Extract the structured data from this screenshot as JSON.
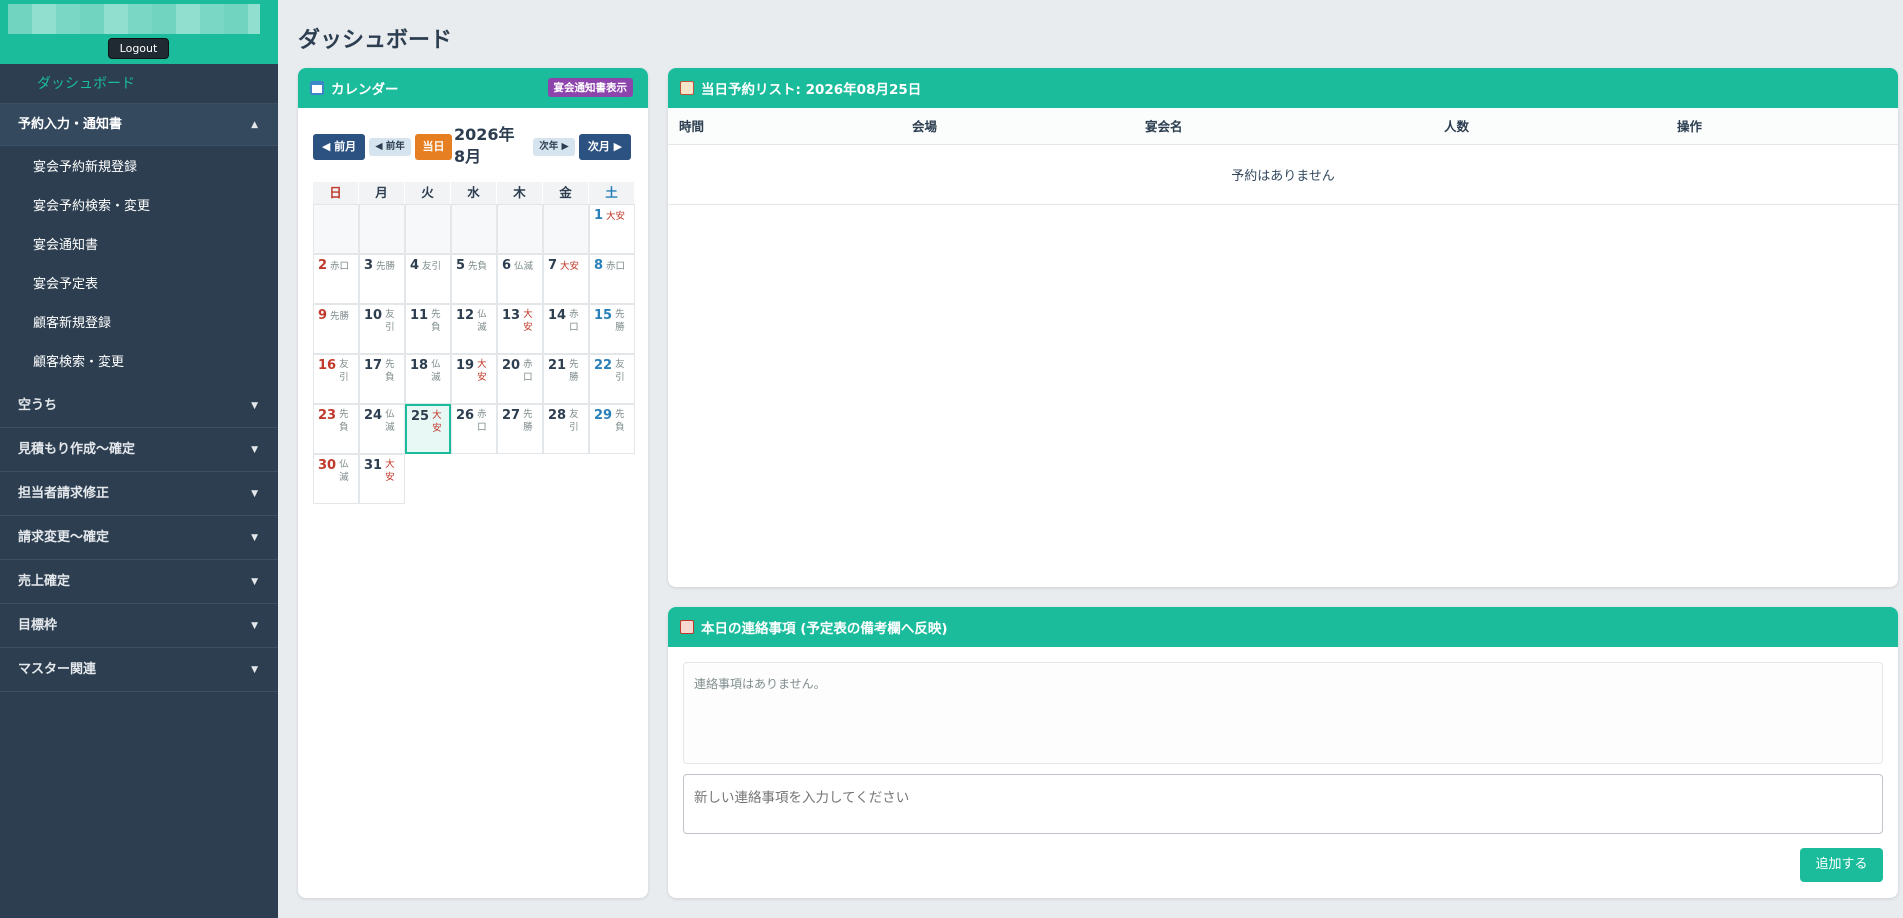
{
  "sidebar": {
    "logout": "Logout",
    "dashboard": "ダッシュボード",
    "sections": [
      {
        "label": "予約入力・通知書",
        "open": true
      },
      {
        "label": "空うち"
      },
      {
        "label": "見積もり作成〜確定"
      },
      {
        "label": "担当者請求修正"
      },
      {
        "label": "請求変更〜確定"
      },
      {
        "label": "売上確定"
      },
      {
        "label": "目標枠"
      },
      {
        "label": "マスター関連"
      }
    ],
    "subitems": [
      "宴会予約新規登録",
      "宴会予約検索・変更",
      "宴会通知書",
      "宴会予定表",
      "顧客新規登録",
      "顧客検索・変更"
    ],
    "arrow_up": "▲",
    "arrow_down": "▼"
  },
  "page_title": "ダッシュボード",
  "calendar": {
    "title": "カレンダー",
    "notice_button": "宴会通知書表示",
    "prev_month": "◀ 前月",
    "prev_year": "◀ 前年",
    "today": "当日",
    "month_label": "2026年8月",
    "next_year": "次年 ▶",
    "next_month": "次月 ▶",
    "weekdays": [
      "日",
      "月",
      "火",
      "水",
      "木",
      "金",
      "土"
    ],
    "days": [
      {
        "d": "",
        "r": ""
      },
      {
        "d": "",
        "r": ""
      },
      {
        "d": "",
        "r": ""
      },
      {
        "d": "",
        "r": ""
      },
      {
        "d": "",
        "r": ""
      },
      {
        "d": "",
        "r": ""
      },
      {
        "d": "1",
        "r": "大安"
      },
      {
        "d": "2",
        "r": "赤口"
      },
      {
        "d": "3",
        "r": "先勝"
      },
      {
        "d": "4",
        "r": "友引"
      },
      {
        "d": "5",
        "r": "先負"
      },
      {
        "d": "6",
        "r": "仏滅"
      },
      {
        "d": "7",
        "r": "大安"
      },
      {
        "d": "8",
        "r": "赤口"
      },
      {
        "d": "9",
        "r": "先勝"
      },
      {
        "d": "10",
        "r": "友引"
      },
      {
        "d": "11",
        "r": "先負"
      },
      {
        "d": "12",
        "r": "仏滅"
      },
      {
        "d": "13",
        "r": "大安"
      },
      {
        "d": "14",
        "r": "赤口"
      },
      {
        "d": "15",
        "r": "先勝"
      },
      {
        "d": "16",
        "r": "友引"
      },
      {
        "d": "17",
        "r": "先負"
      },
      {
        "d": "18",
        "r": "仏滅"
      },
      {
        "d": "19",
        "r": "大安"
      },
      {
        "d": "20",
        "r": "赤口"
      },
      {
        "d": "21",
        "r": "先勝"
      },
      {
        "d": "22",
        "r": "友引"
      },
      {
        "d": "23",
        "r": "先負"
      },
      {
        "d": "24",
        "r": "仏滅"
      },
      {
        "d": "25",
        "r": "大安",
        "today": true
      },
      {
        "d": "26",
        "r": "赤口"
      },
      {
        "d": "27",
        "r": "先勝"
      },
      {
        "d": "28",
        "r": "友引"
      },
      {
        "d": "29",
        "r": "先負"
      },
      {
        "d": "30",
        "r": "仏滅"
      },
      {
        "d": "31",
        "r": "大安"
      }
    ]
  },
  "reservations": {
    "title": "当日予約リスト: 2026年08月25日",
    "columns": [
      "時間",
      "会場",
      "宴会名",
      "人数",
      "操作"
    ],
    "empty": "予約はありません"
  },
  "notes": {
    "title": "本日の連絡事項 (予定表の備考欄へ反映)",
    "empty": "連絡事項はありません。",
    "placeholder": "新しい連絡事項を入力してください",
    "add_button": "追加する"
  },
  "colors": {
    "accent": "#1abc9c",
    "sidebar": "#2c3e50",
    "sunday": "#c0392b",
    "saturday": "#2980b9",
    "taian": "#c0392b",
    "purple": "#8e44ad",
    "orange": "#e67e22"
  }
}
